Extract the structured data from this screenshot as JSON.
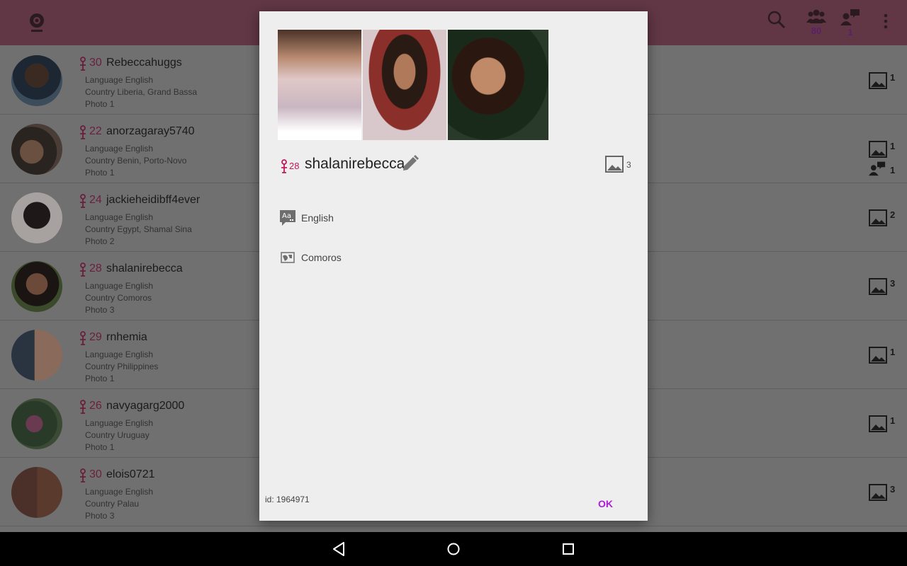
{
  "colors": {
    "accent_pink": "#c2185b",
    "ok_purple": "#b01adb",
    "appbar": "#c06a8a"
  },
  "appbar": {
    "icons": [
      "webcam-icon",
      "search-icon",
      "group-icon",
      "chat-person-icon",
      "more-vert-icon"
    ],
    "group_count": "80",
    "chat_count": "1"
  },
  "list": [
    {
      "age": "30",
      "name": "Rebeccahuggs",
      "language": "Language English",
      "country": "Country Liberia, Grand Bassa",
      "photo": "Photo 1",
      "photo_count": "1",
      "chat_count": ""
    },
    {
      "age": "22",
      "name": "anorzagaray5740",
      "language": "Language English",
      "country": "Country Benin, Porto-Novo",
      "photo": "Photo 1",
      "photo_count": "1",
      "chat_count": "1"
    },
    {
      "age": "24",
      "name": "jackieheidibff4ever",
      "language": "Language English",
      "country": "Country Egypt, Shamal Sina",
      "photo": "Photo 2",
      "photo_count": "2",
      "chat_count": ""
    },
    {
      "age": "28",
      "name": "shalanirebecca",
      "language": "Language English",
      "country": "Country Comoros",
      "photo": "Photo 3",
      "photo_count": "3",
      "chat_count": ""
    },
    {
      "age": "29",
      "name": "rnhemia",
      "language": "Language English",
      "country": "Country Philippines",
      "photo": "Photo 1",
      "photo_count": "1",
      "chat_count": ""
    },
    {
      "age": "26",
      "name": "navyagarg2000",
      "language": "Language English",
      "country": "Country Uruguay",
      "photo": "Photo 1",
      "photo_count": "1",
      "chat_count": ""
    },
    {
      "age": "30",
      "name": "elois0721",
      "language": "Language English",
      "country": "Country Palau",
      "photo": "Photo 3",
      "photo_count": "3",
      "chat_count": ""
    }
  ],
  "dialog": {
    "age": "28",
    "name": "shalanirebecca",
    "photo_count": "3",
    "language": "English",
    "country": "Comoros",
    "id_text": "id: 1964971",
    "ok_label": "OK"
  },
  "navbar": {
    "icons": [
      "back-icon",
      "home-icon",
      "recents-icon"
    ]
  }
}
